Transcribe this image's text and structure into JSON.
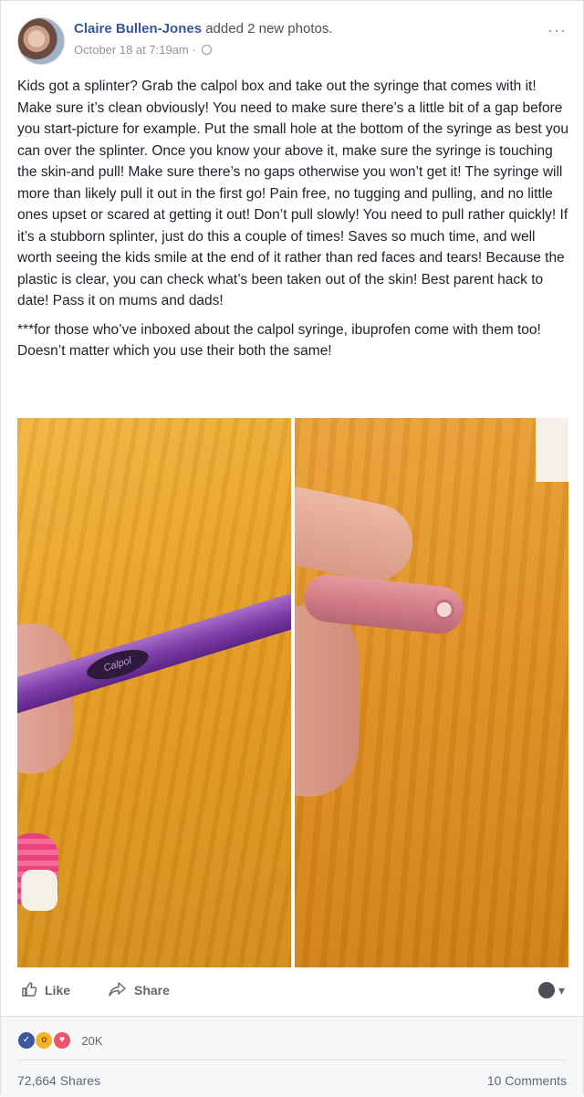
{
  "post": {
    "author": "Claire Bullen-Jones",
    "action": "added 2 new photos.",
    "timestamp": "October 18 at 7:19am",
    "more_label": "···",
    "paragraphs": [
      "Kids got a splinter? Grab the calpol box and take out the syringe that comes with it! Make sure it’s clean obviously! You need to make sure there’s a little bit of a gap before you start-picture for example. Put the small hole at the bottom of the syringe as best you can over the splinter. Once you know your above it, make sure the syringe is touching the skin-and pull! Make sure there’s no gaps otherwise you won’t get it! The syringe will more than likely pull it out in the first go! Pain free, no tugging and pulling, and no little ones upset or scared at getting it out! Don’t pull slowly! You need to pull rather quickly! If it’s a stubborn splinter, just do this a couple of times! Saves so much time, and well worth seeing the kids smile at the end of it rather than red faces and tears! Because the plastic is clear, you can check what’s been taken out of the skin! Best parent hack to date! Pass it on mums and dads!",
      "***for those who’ve inboxed about the calpol syringe, ibuprofen come with them too! Doesn’t matter which you use their both the same!"
    ],
    "photo_logo_text": "Calpol"
  },
  "actions": {
    "like_label": "Like",
    "share_label": "Share",
    "audience_caret": "▾"
  },
  "stats": {
    "reaction_count": "20K",
    "shares": "72,664 Shares",
    "comments": "10 Comments"
  },
  "icons": {
    "like": "thumbs-up-icon",
    "share": "share-arrow-icon",
    "globe": "globe-icon",
    "audience": "audience-icon"
  },
  "colors": {
    "link": "#365899",
    "meta": "#90949c",
    "like_reaction": "#3b5998",
    "wow_reaction": "#f7b125",
    "love_reaction": "#f25268"
  }
}
